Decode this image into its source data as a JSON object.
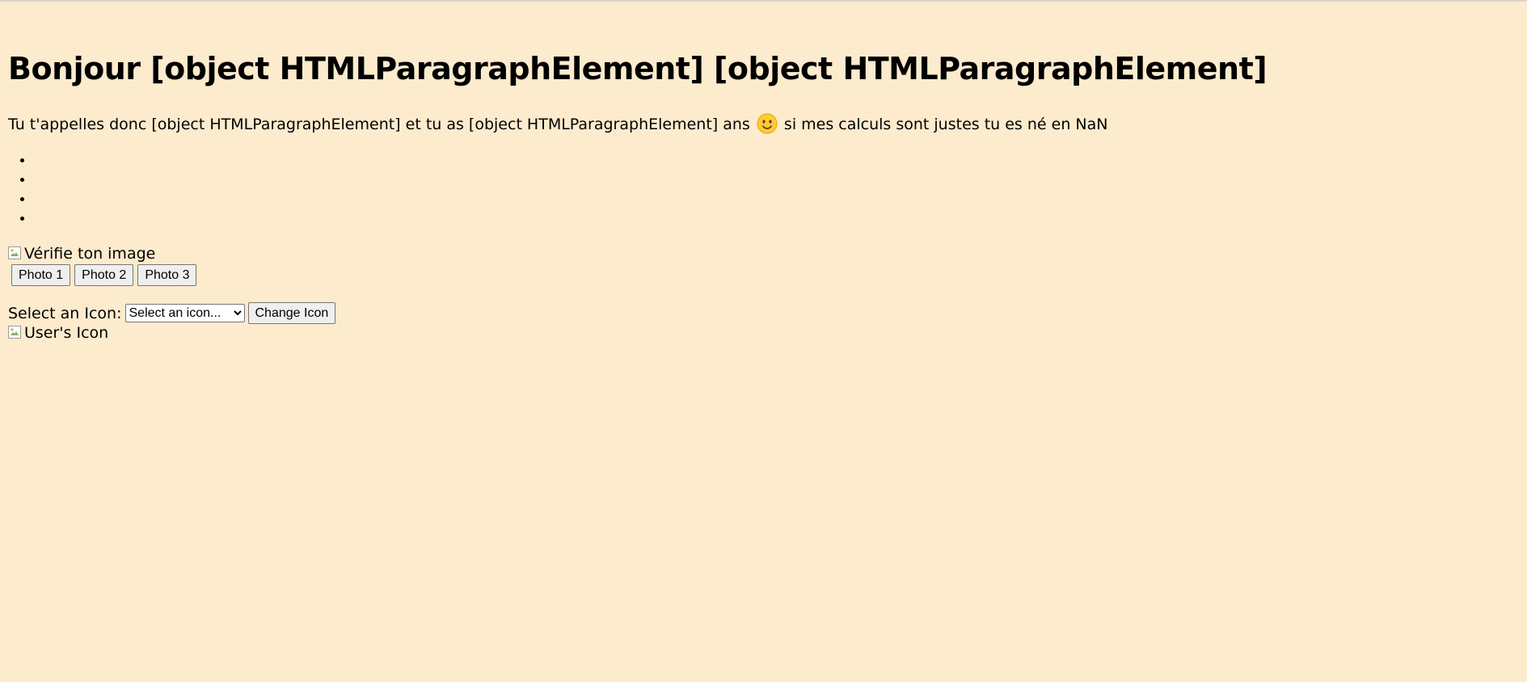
{
  "heading": "Bonjour [object HTMLParagraphElement] [object HTMLParagraphElement]",
  "intro": {
    "before_emoji": "Tu t'appelles donc [object HTMLParagraphElement] et tu as [object HTMLParagraphElement] ans",
    "after_emoji": "si mes calculs sont justes tu es né en NaN",
    "emoji_icon": "smiling-face-icon"
  },
  "list_items": [
    "",
    "",
    "",
    ""
  ],
  "image": {
    "alt": "Vérifie ton image"
  },
  "photo_buttons": [
    "Photo 1",
    "Photo 2",
    "Photo 3"
  ],
  "icon_picker": {
    "label": "Select an Icon:",
    "selected": "Select an icon...",
    "button_label": "Change Icon"
  },
  "user_icon": {
    "alt": "User's Icon"
  },
  "colors": {
    "background": "#fdebcd"
  }
}
